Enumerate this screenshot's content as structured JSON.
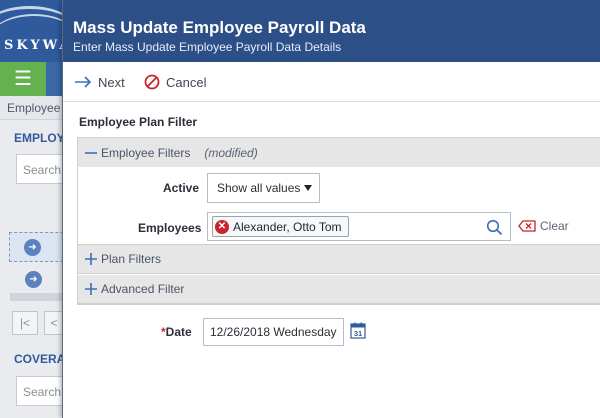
{
  "background": {
    "logo_text": "SKYWA",
    "menu_icon": "hamburger-icon",
    "breadcrumb": "Employee",
    "section1_title": "EMPLOY",
    "section1_search_placeholder": "Search",
    "section2_title": "COVERA",
    "section2_search_placeholder": "Search",
    "pager_first": "|<",
    "pager_prev": "<"
  },
  "dialog": {
    "title": "Mass Update Employee Payroll Data",
    "subtitle": "Enter Mass Update Employee Payroll Data Details"
  },
  "toolbar": {
    "next_label": "Next",
    "cancel_label": "Cancel"
  },
  "filter": {
    "title": "Employee Plan Filter",
    "employee_filters": {
      "label": "Employee Filters",
      "status": "(modified)",
      "active_label": "Active",
      "active_value": "Show all values",
      "employees_label": "Employees",
      "selected_employees": [
        "Alexander, Otto Tom"
      ],
      "clear_label": "Clear"
    },
    "plan_filters_label": "Plan Filters",
    "advanced_filter_label": "Advanced Filter"
  },
  "date": {
    "label": "Date",
    "required_marker": "*",
    "value": "12/26/2018 Wednesday",
    "calendar_day": "31"
  },
  "colors": {
    "header_blue": "#2c4f87",
    "remove_red": "#c9242b",
    "menu_green": "#63b24f"
  }
}
